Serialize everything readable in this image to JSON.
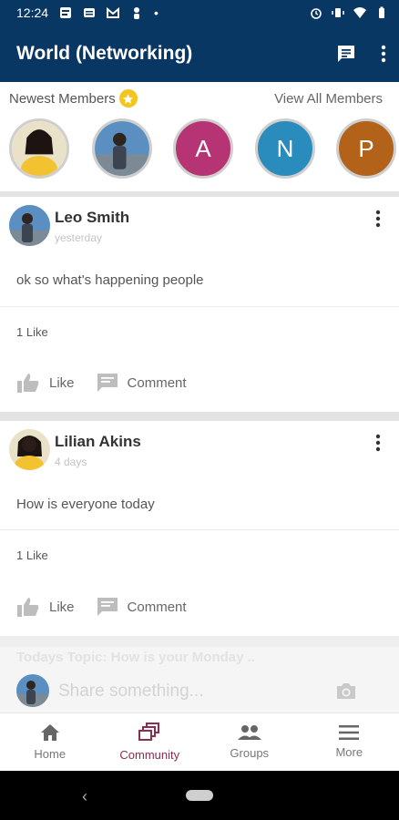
{
  "status_bar": {
    "time": "12:24",
    "dot": "•"
  },
  "app_bar": {
    "title": "World (Networking)",
    "icons": [
      "chat-icon",
      "more-vert-icon"
    ]
  },
  "members": {
    "title": "Newest Members",
    "view_all": "View All Members",
    "avatars": [
      {
        "type": "photo",
        "color": "#f2c230"
      },
      {
        "type": "photo",
        "color": "#5b8fc1"
      },
      {
        "type": "letter",
        "letter": "A",
        "color": "#b63474"
      },
      {
        "type": "letter",
        "letter": "N",
        "color": "#2a8cbd"
      },
      {
        "type": "letter",
        "letter": "P",
        "color": "#b3621a"
      }
    ]
  },
  "posts": [
    {
      "author": "Leo Smith",
      "time": "yesterday",
      "text": "ok so what's happening people",
      "likes": "1 Like",
      "like_label": "Like",
      "comment_label": "Comment"
    },
    {
      "author": "Lilian Akins",
      "time": "4 days",
      "text": "How is everyone today",
      "likes": "1 Like",
      "like_label": "Like",
      "comment_label": "Comment"
    }
  ],
  "composer": {
    "topic": "Todays Topic: How is your Monday ..",
    "placeholder": "Share something..."
  },
  "bottom_nav": [
    {
      "label": "Home",
      "icon": "home-icon",
      "active": false
    },
    {
      "label": "Community",
      "icon": "community-icon",
      "active": true
    },
    {
      "label": "Groups",
      "icon": "groups-icon",
      "active": false
    },
    {
      "label": "More",
      "icon": "menu-icon",
      "active": false
    }
  ],
  "colors": {
    "primary": "#093764",
    "accent": "#8b2d4f",
    "star": "#f3c51f"
  }
}
